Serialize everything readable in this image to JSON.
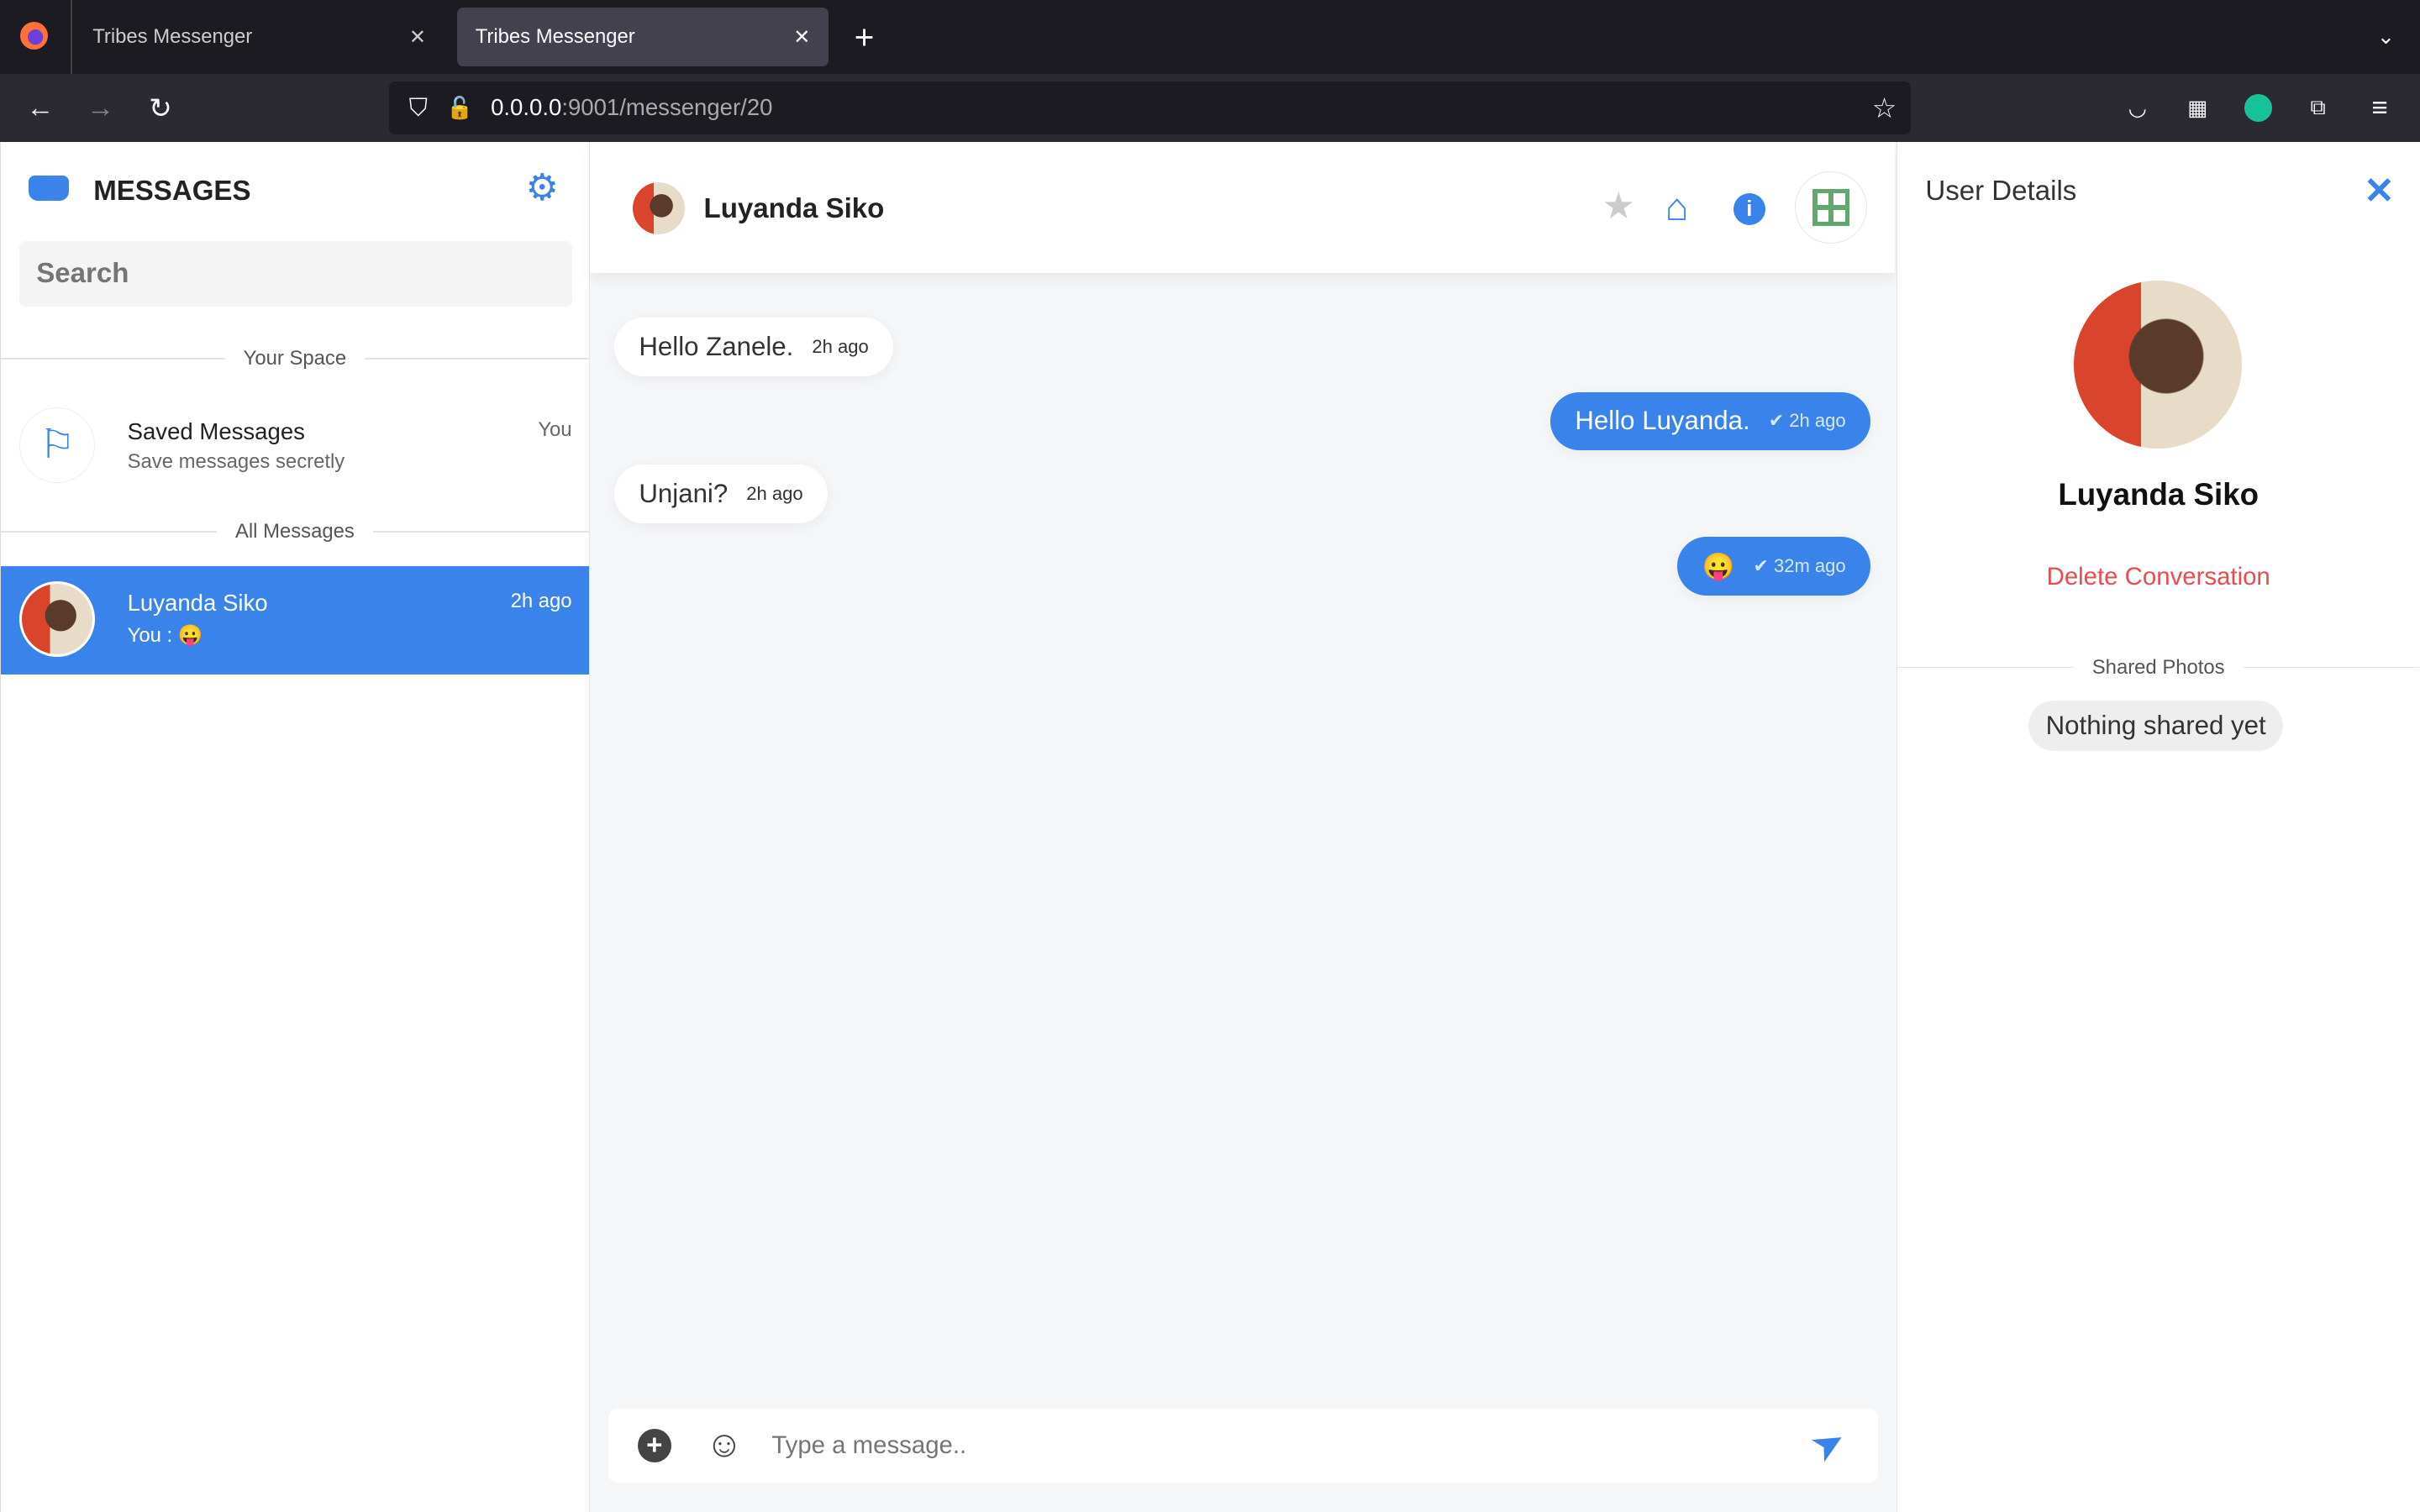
{
  "browser": {
    "tabs": [
      {
        "title": "Tribes Messenger"
      },
      {
        "title": "Tribes Messenger"
      }
    ],
    "url_host": "0.0.0.0",
    "url_rest": ":9001/messenger/20"
  },
  "sidebar": {
    "title": "MESSAGES",
    "search_placeholder": "Search",
    "your_space": "Your Space",
    "saved": {
      "title": "Saved Messages",
      "subtitle": "Save messages secretly",
      "meta": "You"
    },
    "all_messages": "All Messages",
    "contacts": [
      {
        "name": "Luyanda Siko",
        "preview": "You : 😛",
        "time": "2h ago"
      }
    ]
  },
  "chat": {
    "contact_name": "Luyanda Siko",
    "messages": [
      {
        "text": "Hello Zanele.",
        "time": "2h ago",
        "dir": "in"
      },
      {
        "text": "Hello Luyanda.",
        "time": "2h ago",
        "dir": "out"
      },
      {
        "text": "Unjani?",
        "time": "2h ago",
        "dir": "in"
      },
      {
        "text": "😛",
        "time": "32m ago",
        "dir": "out"
      }
    ],
    "input_placeholder": "Type a message.."
  },
  "details": {
    "title": "User Details",
    "name": "Luyanda Siko",
    "delete": "Delete Conversation",
    "shared_photos": "Shared Photos",
    "nothing": "Nothing shared yet"
  },
  "colors": {
    "accent": "#3a83ea",
    "danger": "#e84c4c"
  }
}
